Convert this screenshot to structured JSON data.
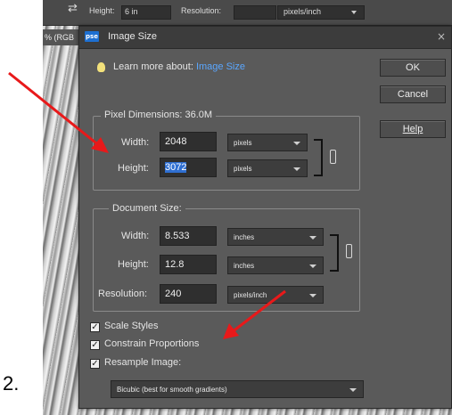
{
  "step_label": "2.",
  "toolbar": {
    "height_label": "Height:",
    "height_value": "6 in",
    "resolution_label": "Resolution:",
    "resolution_unit": "pixels/inch"
  },
  "doc_tab": "% (RGB",
  "dialog": {
    "app_badge": "pse",
    "title": "Image Size",
    "close_glyph": "×",
    "learn_prefix": "Learn more about: ",
    "learn_link": "Image Size",
    "buttons": {
      "ok": "OK",
      "cancel": "Cancel",
      "help": "Help"
    },
    "pixel_dimensions": {
      "title": "Pixel Dimensions: 36.0M",
      "width_label": "Width:",
      "width_value": "2048",
      "width_unit": "pixels",
      "height_label": "Height:",
      "height_value": "3072",
      "height_unit": "pixels"
    },
    "document_size": {
      "title": "Document Size:",
      "width_label": "Width:",
      "width_value": "8.533",
      "width_unit": "inches",
      "height_label": "Height:",
      "height_value": "12.8",
      "height_unit": "inches",
      "resolution_label": "Resolution:",
      "resolution_value": "240",
      "resolution_unit": "pixels/inch"
    },
    "options": {
      "scale_styles": "Scale Styles",
      "constrain": "Constrain Proportions",
      "resample": "Resample Image:",
      "resample_method": "Bicubic (best for smooth gradients)",
      "checked": true
    }
  },
  "colors": {
    "annotation_arrow": "#e8191a",
    "link": "#5aa7ff",
    "selection": "#2f6fd1"
  }
}
